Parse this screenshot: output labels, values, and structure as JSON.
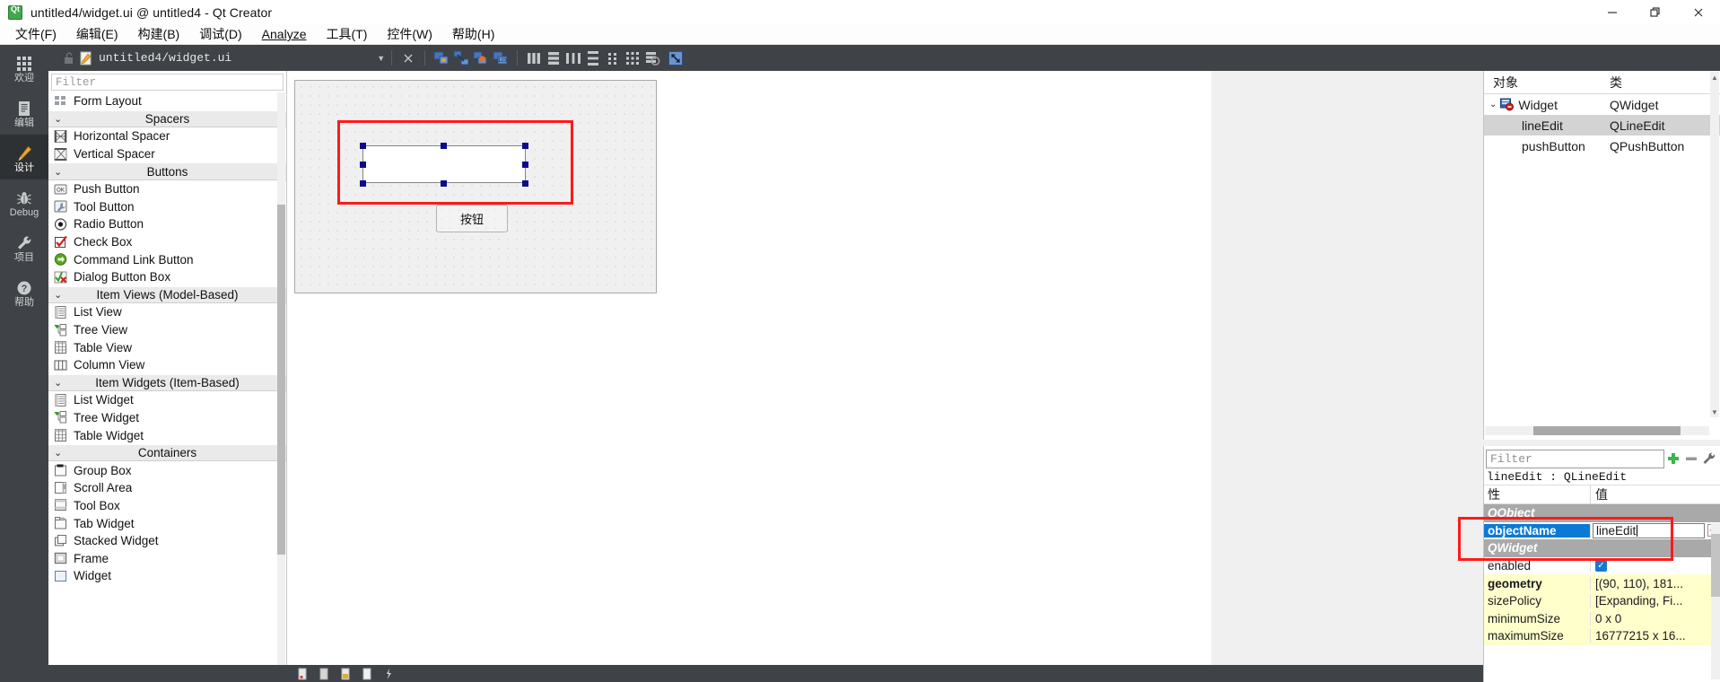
{
  "window": {
    "title": "untitled4/widget.ui @ untitled4 - Qt Creator",
    "logo_label": "Qt",
    "minimize": "minimize-button",
    "maximize": "restore-button",
    "close": "close-button"
  },
  "menubar": {
    "items": [
      {
        "text": "文件(F)",
        "mnemonic": "F"
      },
      {
        "text": "编辑(E)",
        "mnemonic": "E"
      },
      {
        "text": "构建(B)",
        "mnemonic": "B"
      },
      {
        "text": "调试(D)",
        "mnemonic": "D"
      },
      {
        "text": "Analyze",
        "mnemonic": "A"
      },
      {
        "text": "工具(T)",
        "mnemonic": "T"
      },
      {
        "text": "控件(W)",
        "mnemonic": "W"
      },
      {
        "text": "帮助(H)",
        "mnemonic": "H"
      }
    ]
  },
  "modebar": {
    "items": [
      {
        "label": "欢迎",
        "icon": "grid-icon",
        "active": false
      },
      {
        "label": "编辑",
        "icon": "document-icon",
        "active": false
      },
      {
        "label": "设计",
        "icon": "pencil-icon",
        "active": true
      },
      {
        "label": "Debug",
        "icon": "bug-icon",
        "active": false
      },
      {
        "label": "项目",
        "icon": "wrench-icon",
        "active": false
      },
      {
        "label": "帮助",
        "icon": "question-icon",
        "active": false
      }
    ]
  },
  "editor_toolbar": {
    "filename": "untitled4/widget.ui",
    "lock_icon": "unlocked-icon",
    "file_icon": "ui-file-icon",
    "dropdown_icon": "chevron-down-icon",
    "close_icon": "close-icon",
    "buttons": [
      "edit-widgets-icon",
      "edit-signals-slots-icon",
      "edit-buddies-icon",
      "edit-tab-order-icon",
      "layout-horizontally-icon",
      "layout-vertically-icon",
      "layout-horizontal-splitter-icon",
      "layout-vertical-splitter-icon",
      "layout-form-icon",
      "layout-grid-icon",
      "break-layout-icon",
      "adjust-size-icon"
    ]
  },
  "widgetbox": {
    "filter_placeholder": "Filter",
    "rows": [
      {
        "kind": "item",
        "label": "Form Layout",
        "icon": "form-layout-icon"
      },
      {
        "kind": "category",
        "label": "Spacers",
        "expanded": true
      },
      {
        "kind": "item",
        "label": "Horizontal Spacer",
        "icon": "horizontal-spacer-icon"
      },
      {
        "kind": "item",
        "label": "Vertical Spacer",
        "icon": "vertical-spacer-icon"
      },
      {
        "kind": "category",
        "label": "Buttons",
        "expanded": true
      },
      {
        "kind": "item",
        "label": "Push Button",
        "icon": "push-button-icon"
      },
      {
        "kind": "item",
        "label": "Tool Button",
        "icon": "tool-button-icon"
      },
      {
        "kind": "item",
        "label": "Radio Button",
        "icon": "radio-button-icon"
      },
      {
        "kind": "item",
        "label": "Check Box",
        "icon": "check-box-icon"
      },
      {
        "kind": "item",
        "label": "Command Link Button",
        "icon": "command-link-button-icon"
      },
      {
        "kind": "item",
        "label": "Dialog Button Box",
        "icon": "dialog-button-box-icon"
      },
      {
        "kind": "category",
        "label": "Item Views (Model-Based)",
        "expanded": true
      },
      {
        "kind": "item",
        "label": "List View",
        "icon": "list-view-icon"
      },
      {
        "kind": "item",
        "label": "Tree View",
        "icon": "tree-view-icon"
      },
      {
        "kind": "item",
        "label": "Table View",
        "icon": "table-view-icon"
      },
      {
        "kind": "item",
        "label": "Column View",
        "icon": "column-view-icon"
      },
      {
        "kind": "category",
        "label": "Item Widgets (Item-Based)",
        "expanded": true
      },
      {
        "kind": "item",
        "label": "List Widget",
        "icon": "list-widget-icon"
      },
      {
        "kind": "item",
        "label": "Tree Widget",
        "icon": "tree-widget-icon"
      },
      {
        "kind": "item",
        "label": "Table Widget",
        "icon": "table-widget-icon"
      },
      {
        "kind": "category",
        "label": "Containers",
        "expanded": true
      },
      {
        "kind": "item",
        "label": "Group Box",
        "icon": "group-box-icon"
      },
      {
        "kind": "item",
        "label": "Scroll Area",
        "icon": "scroll-area-icon"
      },
      {
        "kind": "item",
        "label": "Tool Box",
        "icon": "tool-box-icon"
      },
      {
        "kind": "item",
        "label": "Tab Widget",
        "icon": "tab-widget-icon"
      },
      {
        "kind": "item",
        "label": "Stacked Widget",
        "icon": "stacked-widget-icon"
      },
      {
        "kind": "item",
        "label": "Frame",
        "icon": "frame-icon"
      },
      {
        "kind": "item",
        "label": "Widget",
        "icon": "widget-icon"
      }
    ]
  },
  "canvas": {
    "form_name": "Widget",
    "push_button_text": "按钮",
    "line_edit_text": "",
    "selection_highlight_color": "#ff1a1a",
    "handle_color": "#0b0b8b"
  },
  "object_inspector": {
    "columns": [
      "对象",
      "类"
    ],
    "rows": [
      {
        "object": "Widget",
        "class": "QWidget",
        "indent": 0,
        "expanded": true,
        "selected": false,
        "icon": "widget-node-icon"
      },
      {
        "object": "lineEdit",
        "class": "QLineEdit",
        "indent": 1,
        "selected": true,
        "icon": ""
      },
      {
        "object": "pushButton",
        "class": "QPushButton",
        "indent": 1,
        "selected": false,
        "icon": ""
      }
    ]
  },
  "property_editor": {
    "filter_placeholder": "Filter",
    "add_icon": "plus-icon",
    "remove_icon": "minus-icon",
    "config_icon": "wrench-icon",
    "subject": "lineEdit : QLineEdit",
    "columns": [
      "性",
      "值"
    ],
    "rows": [
      {
        "name": "QObject",
        "value": "",
        "group": true
      },
      {
        "name": "objectName",
        "value": "lineEdit",
        "selected": true,
        "editing": true,
        "revert": true
      },
      {
        "name": "QWidget",
        "value": "",
        "group": true
      },
      {
        "name": "enabled",
        "value": "",
        "checkbox": true,
        "highlight": false
      },
      {
        "name": "geometry",
        "value": "[(90, 110), 181...",
        "bold": true,
        "highlight": true
      },
      {
        "name": "sizePolicy",
        "value": "[Expanding, Fi...",
        "highlight": true
      },
      {
        "name": "minimumSize",
        "value": "0 x 0",
        "highlight": true
      },
      {
        "name": "maximumSize",
        "value": "16777215 x 16...",
        "highlight": true
      }
    ]
  },
  "bottombar": {
    "icons": [
      "issues-icon",
      "search-results-icon",
      "application-output-icon",
      "compile-output-icon",
      "debugger-console-icon"
    ]
  },
  "colors": {
    "dark_chrome": "#3f4246",
    "dark_chrome_active": "#2e3134",
    "accent_blue": "#0b7ad6",
    "highlight_red": "#ff1a1a",
    "property_yellow": "#ffffcc",
    "selection_gray": "#d3d3d3"
  }
}
